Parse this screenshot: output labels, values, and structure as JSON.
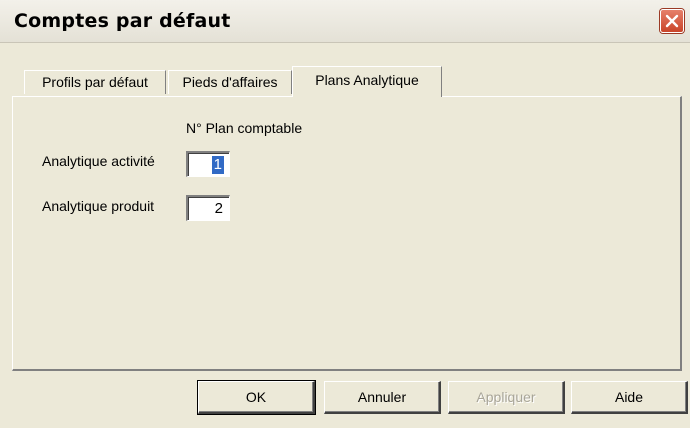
{
  "window": {
    "title": "Comptes par défaut"
  },
  "icons": {
    "close": "close-icon"
  },
  "tabs": [
    {
      "label": "Profils par défaut"
    },
    {
      "label": "Pieds d'affaires"
    },
    {
      "label": "Plans Analytique",
      "active": true
    }
  ],
  "form": {
    "column_header": "N° Plan comptable",
    "fields": [
      {
        "label": "Analytique activité",
        "value": "1",
        "selected": true
      },
      {
        "label": "Analytique produit",
        "value": "2"
      }
    ]
  },
  "buttons": {
    "ok": "OK",
    "cancel": "Annuler",
    "apply": "Appliquer",
    "help": "Aide"
  },
  "colors": {
    "dialog_bg": "#ece9d8",
    "selection": "#316ac5",
    "close_button": "#d0512f"
  }
}
